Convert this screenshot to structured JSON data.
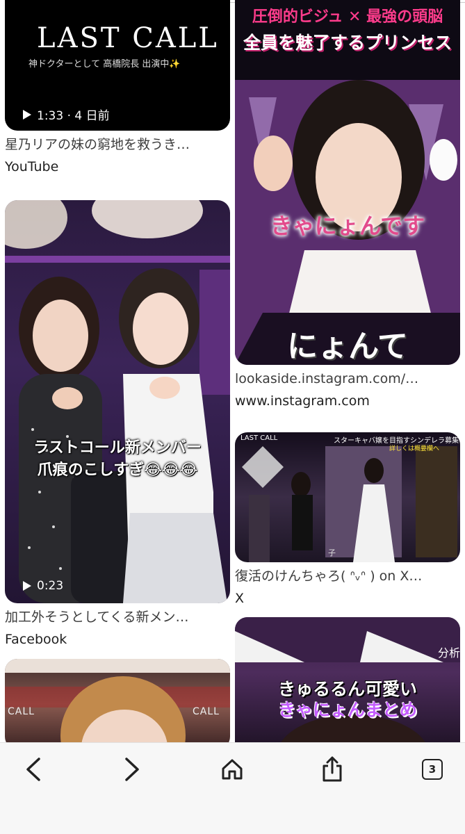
{
  "results": {
    "left": [
      {
        "logo_text": "LAST CALL",
        "overlay_sub": "神ドクターとして 高橋院長 出演中✨",
        "duration": "1:33 · 4 日前",
        "caption": "星乃リアの妹の窮地を救うき…",
        "source": "YouTube"
      },
      {
        "overlay_line1": "ラストコール新メンバー",
        "overlay_line2": "爪痕のこしすぎ😂😂😂",
        "duration": "0:23",
        "caption": "加工外そうとしてくる新メン…",
        "source": "Facebook"
      },
      {
        "overlay_left": "CALL",
        "overlay_right": "CALL"
      }
    ],
    "right": [
      {
        "banner_line1": "圧倒的ビジュ ✕ 最強の頭脳",
        "banner_line2": "全員を魅了するプリンセス",
        "overlay_caption": "きゃにょんです",
        "bottom_text": "にょんて",
        "caption": "lookaside.instagram.com/…",
        "source": "www.instagram.com"
      },
      {
        "corner_logo": "LAST CALL",
        "top_banner": "スターキャバ嬢を目指すシンデレラ募集中",
        "top_banner_sub": "詳しくは概要欄へ",
        "floor_text": "子",
        "caption": "復活のけんちゃろ( ᐢᵥᐢ ) on X…",
        "source": "X"
      },
      {
        "corner_text": "分析",
        "overlay_line1": "きゅるるん可愛い",
        "overlay_line2": "きゃにょんまとめ"
      }
    ]
  },
  "nav": {
    "tab_count": "3"
  },
  "colors": {
    "pink_banner": "#ff3c8c",
    "yellow_text": "#ffe43a",
    "purple_text": "#c45cff"
  }
}
